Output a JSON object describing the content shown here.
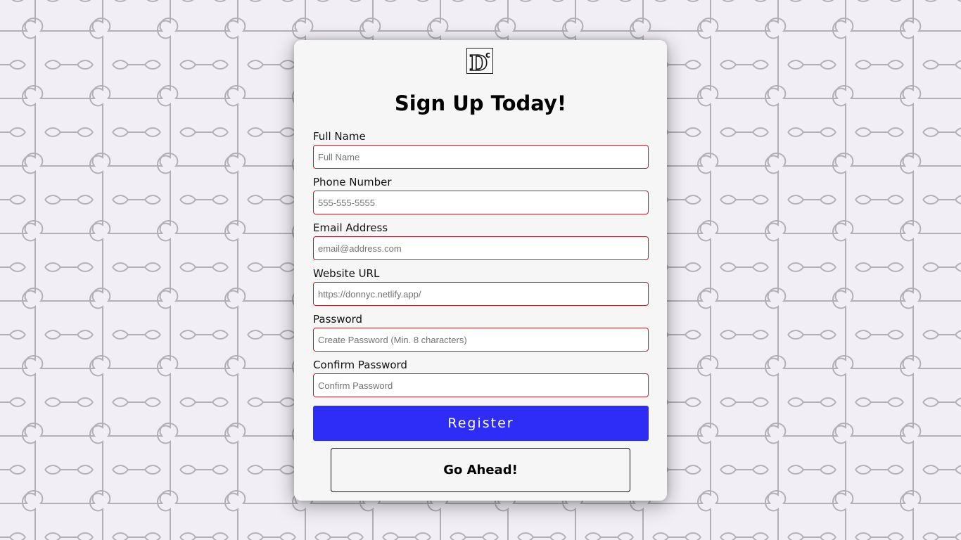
{
  "colors": {
    "page_background": "#f1eff5",
    "puzzle_lines": "#b2b0b6",
    "card_background": "#f6f6f6",
    "input_border": "#b8232c",
    "register_button": "#2d2df7",
    "register_text": "#ffffff"
  },
  "logo": {
    "letter_main": "D",
    "letter_super": "c"
  },
  "form": {
    "title": "Sign Up Today!",
    "fields": [
      {
        "label": "Full Name",
        "placeholder": "Full Name",
        "value": ""
      },
      {
        "label": "Phone Number",
        "placeholder": "555-555-5555",
        "value": ""
      },
      {
        "label": "Email Address",
        "placeholder": "email@address.com",
        "value": ""
      },
      {
        "label": "Website URL",
        "placeholder": "https://donnyc.netlify.app/",
        "value": ""
      },
      {
        "label": "Password",
        "placeholder": "Create Password (Min. 8 characters)",
        "value": ""
      },
      {
        "label": "Confirm Password",
        "placeholder": "Confirm Password",
        "value": ""
      }
    ],
    "register_label": "Register",
    "go_ahead_label": "Go Ahead!"
  },
  "icons": {
    "logo": "dc-monogram-logo",
    "background": "jigsaw-puzzle-pattern"
  }
}
